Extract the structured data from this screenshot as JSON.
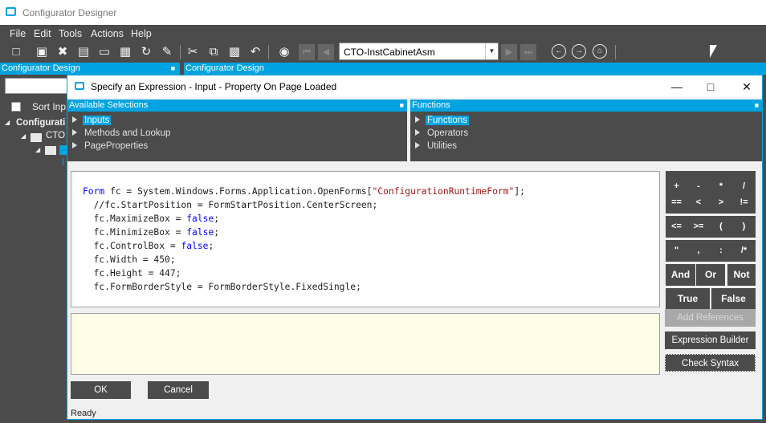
{
  "app": {
    "title": "Configurator Designer"
  },
  "menu": [
    "File",
    "Edit",
    "Tools",
    "Actions",
    "Help"
  ],
  "toolbar": {
    "combo_value": "CTO-InstCabinetAsm"
  },
  "left_pane": {
    "header": "Configurator Design",
    "sort_label": "Sort Inp",
    "tree": {
      "root": "Configurati",
      "child": "CTO",
      "leaf": "I"
    }
  },
  "right_pane": {
    "header": "Configurator Design"
  },
  "dialog": {
    "title": "Specify an Expression - Input  - Property On Page Loaded",
    "available": {
      "header": "Available Selections",
      "items": [
        "Inputs",
        "Methods and Lookup",
        "PageProperties"
      ]
    },
    "functions": {
      "header": "Functions",
      "items": [
        "Functions",
        "Operators",
        "Utilities"
      ]
    },
    "code": {
      "line1_kw": "Form",
      "line1_mid": " fc = System.Windows.Forms.Application.OpenForms[",
      "line1_str": "\"ConfigurationRuntimeForm\"",
      "line1_end": "];",
      "line2": "  //fc.StartPosition = FormStartPosition.CenterScreen;",
      "line3_a": "  fc.MaximizeBox = ",
      "line3_kw": "false",
      "line3_b": ";",
      "line4_a": "  fc.MinimizeBox = ",
      "line4_kw": "false",
      "line4_b": ";",
      "line5_a": "  fc.ControlBox = ",
      "line5_kw": "false",
      "line5_b": ";",
      "line6": "  fc.Width = 450;",
      "line7": "  fc.Height = 447;",
      "line8": "  fc.FormBorderStyle = FormBorderStyle.FixedSingle;"
    },
    "keypad": {
      "row1": [
        "+",
        "-",
        "*",
        "/"
      ],
      "row2": [
        "==",
        "<",
        ">",
        "!="
      ],
      "row3": [
        "<=",
        ">=",
        "(",
        ")"
      ],
      "row4": [
        "\"",
        ",",
        ":",
        "/*"
      ],
      "row5": [
        "And",
        "Or",
        "Not"
      ],
      "row6": [
        "True",
        "False"
      ]
    },
    "actions": {
      "add_references": "Add References",
      "expression_builder": "Expression Builder",
      "check_syntax": "Check Syntax"
    },
    "ok": "OK",
    "cancel": "Cancel",
    "status": "Ready"
  }
}
